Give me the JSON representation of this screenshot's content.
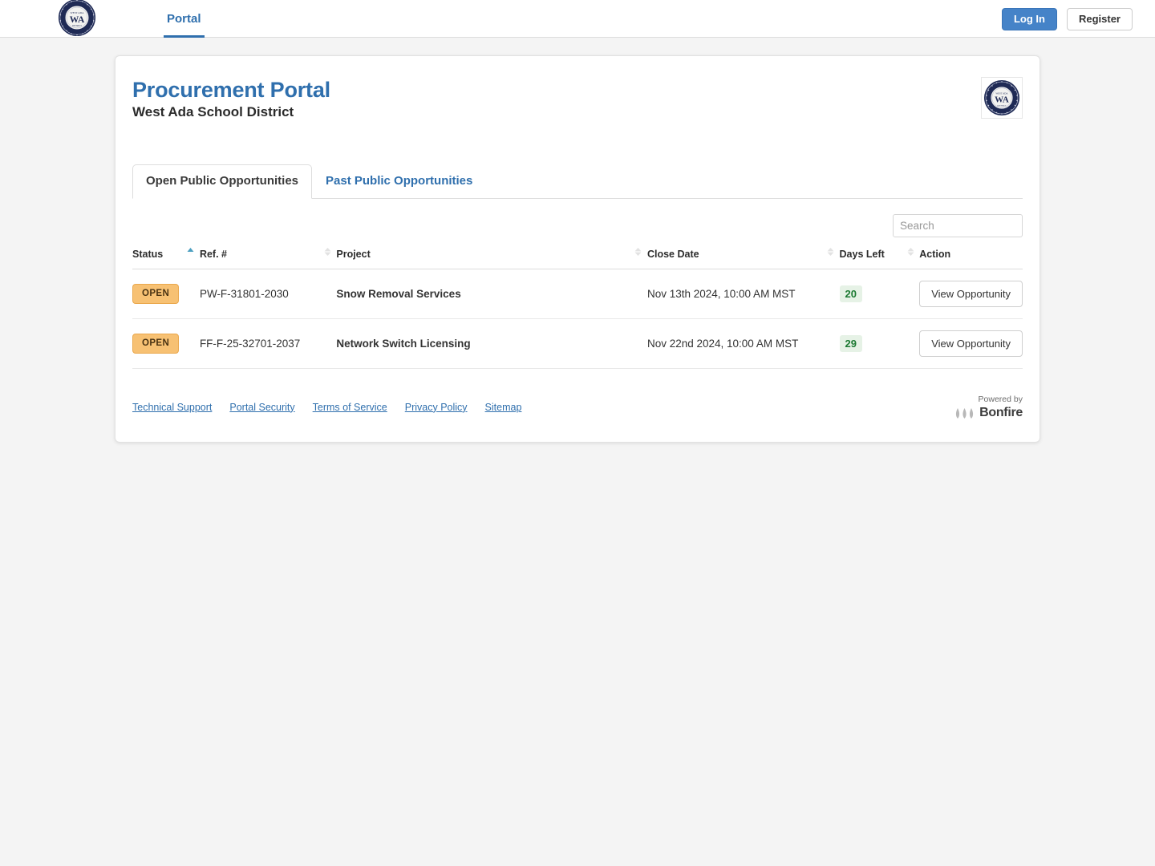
{
  "topbar": {
    "logo_icon": "west-ada-seal-icon",
    "nav": [
      {
        "label": "Portal",
        "active": true
      }
    ],
    "login_label": "Log In",
    "register_label": "Register"
  },
  "header": {
    "title": "Procurement Portal",
    "subtitle": "West Ada School District",
    "seal_icon": "west-ada-seal-icon"
  },
  "tabs": [
    {
      "label": "Open Public Opportunities",
      "active": true
    },
    {
      "label": "Past Public Opportunities",
      "active": false
    }
  ],
  "search": {
    "placeholder": "Search",
    "value": ""
  },
  "table": {
    "columns": [
      {
        "label": "Status",
        "sortable": true,
        "sort": "asc"
      },
      {
        "label": "Ref. #",
        "sortable": true,
        "sort": "none"
      },
      {
        "label": "Project",
        "sortable": true,
        "sort": "none"
      },
      {
        "label": "Close Date",
        "sortable": true,
        "sort": "none"
      },
      {
        "label": "Days Left",
        "sortable": true,
        "sort": "none"
      },
      {
        "label": "Action",
        "sortable": false,
        "sort": "none"
      }
    ],
    "rows": [
      {
        "status": "OPEN",
        "ref": "PW-F-31801-2030",
        "project": "Snow Removal Services",
        "close_date": "Nov 13th 2024, 10:00 AM MST",
        "days_left": "20",
        "action_label": "View Opportunity"
      },
      {
        "status": "OPEN",
        "ref": "FF-F-25-32701-2037",
        "project": "Network Switch Licensing",
        "close_date": "Nov 22nd 2024, 10:00 AM MST",
        "days_left": "29",
        "action_label": "View Opportunity"
      }
    ]
  },
  "footer": {
    "links": [
      "Technical Support",
      "Portal Security",
      "Terms of Service",
      "Privacy Policy",
      "Sitemap"
    ],
    "powered_by_label": "Powered by",
    "powered_by_brand": "Bonfire",
    "powered_by_icon": "bonfire-flames-icon"
  },
  "colors": {
    "accent_blue": "#2f6fad",
    "login_button": "#4583c8",
    "status_open_bg": "#f7c173",
    "days_left_bg": "#e6f2e6",
    "days_left_text": "#1c7a32",
    "page_background": "#f4f4f4"
  }
}
